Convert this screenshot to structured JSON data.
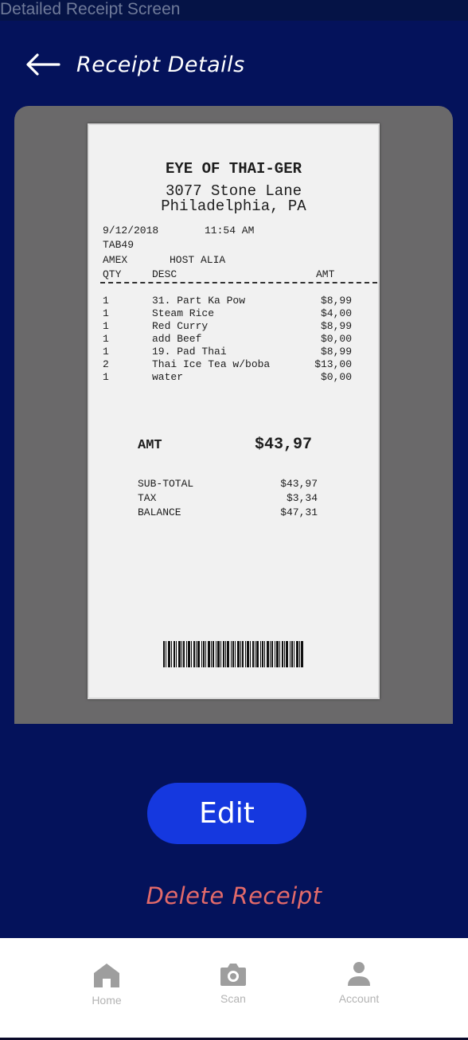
{
  "screen_label": "Detailed Receipt Screen",
  "header": {
    "title": "Receipt Details",
    "back_icon": "arrow-left-icon"
  },
  "receipt": {
    "store_name": "EYE OF THAI-GER",
    "address_line1": "3077 Stone Lane",
    "address_line2": "Philadelphia, PA",
    "date": "9/12/2018",
    "time": "11:54 AM",
    "tab": "TAB49",
    "payment": "AMEX",
    "host": "HOST ALIA",
    "col_qty": "QTY",
    "col_desc": "DESC",
    "col_amt": "AMT",
    "items": [
      {
        "qty": "1",
        "desc": "31. Part Ka Pow",
        "amt": "$8,99"
      },
      {
        "qty": "1",
        "desc": "Steam Rice",
        "amt": "$4,00"
      },
      {
        "qty": "1",
        "desc": "Red Curry",
        "amt": "$8,99"
      },
      {
        "qty": "1",
        "desc": "add Beef",
        "amt": "$0,00"
      },
      {
        "qty": "1",
        "desc": "19. Pad Thai",
        "amt": "$8,99"
      },
      {
        "qty": "2",
        "desc": "Thai Ice Tea w/boba",
        "amt": "$13,00"
      },
      {
        "qty": "1",
        "desc": "water",
        "amt": "$0,00"
      }
    ],
    "amt_label": "AMT",
    "amt_value": "$43,97",
    "subtotal_label": "SUB-TOTAL",
    "subtotal_value": "$43,97",
    "tax_label": "TAX",
    "tax_value": "$3,34",
    "balance_label": "BALANCE",
    "balance_value": "$47,31"
  },
  "actions": {
    "edit_label": "Edit",
    "delete_label": "Delete Receipt"
  },
  "nav": {
    "items": [
      {
        "label": "Home",
        "icon": "home-icon"
      },
      {
        "label": "Scan",
        "icon": "camera-icon"
      },
      {
        "label": "Account",
        "icon": "user-icon"
      }
    ]
  },
  "colors": {
    "background": "#04125b",
    "accent": "#1538df",
    "danger": "#e36a6a",
    "nav_inactive": "#b3b3b3"
  }
}
